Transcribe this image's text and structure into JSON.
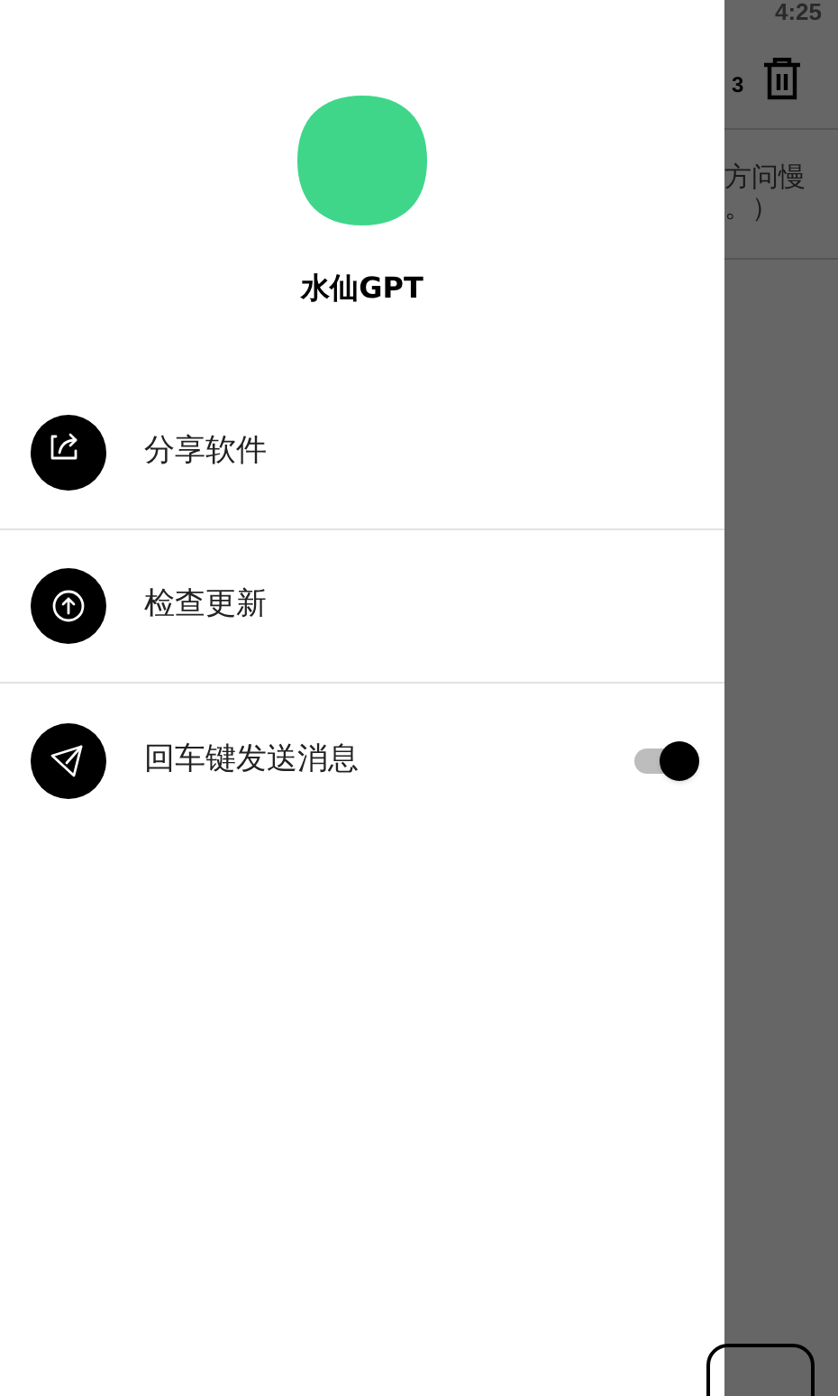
{
  "status_bar": {
    "time": "4:25"
  },
  "background": {
    "member_count": "3",
    "message_lines": [
      "方问慢",
      "。）"
    ]
  },
  "drawer": {
    "app_name": "水仙GPT",
    "items": [
      {
        "kind": "share",
        "label": "分享软件"
      },
      {
        "kind": "update",
        "label": "检查更新"
      },
      {
        "kind": "enter_send",
        "label": "回车键发送消息",
        "on": true
      }
    ]
  }
}
